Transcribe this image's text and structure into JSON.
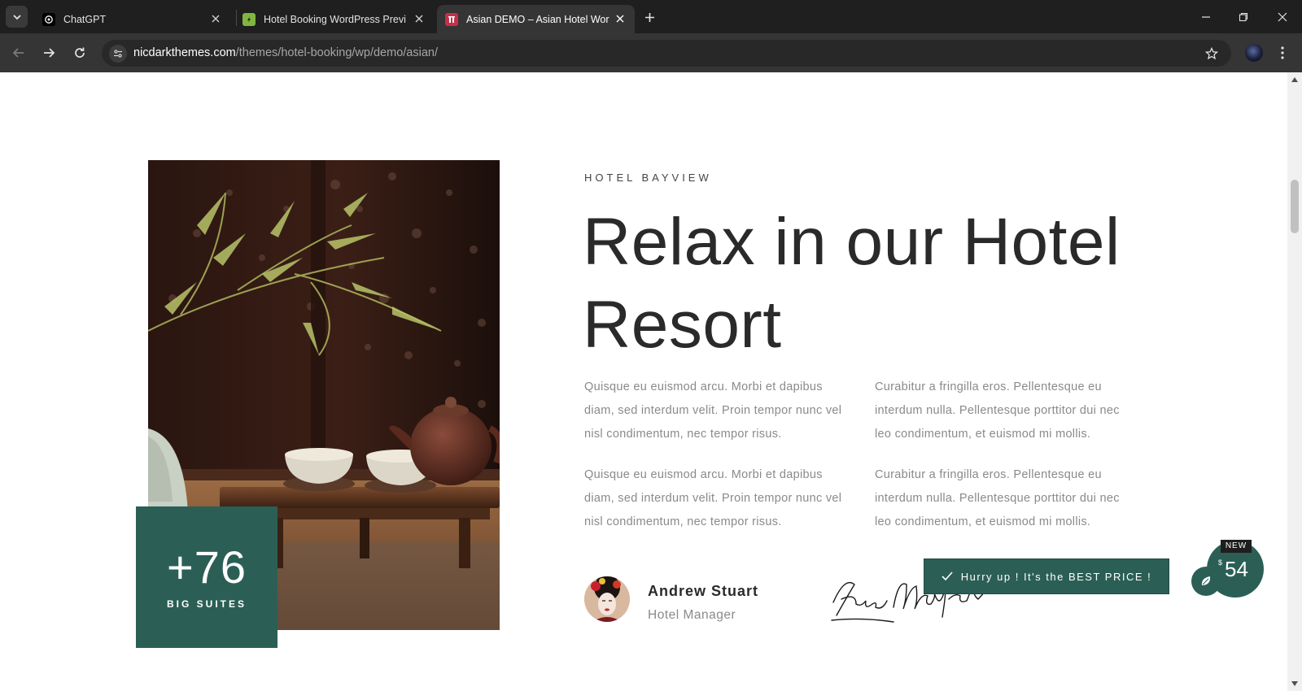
{
  "browser": {
    "tabs": [
      {
        "title": "ChatGPT",
        "icon": "chatgpt-icon",
        "active": false
      },
      {
        "title": "Hotel Booking WordPress Previ",
        "icon": "envato-icon",
        "active": false
      },
      {
        "title": "Asian DEMO – Asian Hotel Wor",
        "icon": "hotel-site-icon",
        "active": true
      }
    ],
    "url_host": "nicdarkthemes.com",
    "url_path": "/themes/hotel-booking/wp/demo/asian/"
  },
  "section": {
    "eyebrow": "HOTEL BAYVIEW",
    "headline_line1": "Relax in our Hotel",
    "headline_line2": "Resort",
    "paragraphs": [
      "Quisque eu euismod arcu. Morbi et dapibus diam, sed interdum velit. Proin tempor nunc vel nisl condimentum, nec tempor risus.",
      "Curabitur a fringilla eros. Pellentesque eu interdum nulla. Pellentesque porttitor dui nec leo condimentum, et euismod mi mollis.",
      "Quisque eu euismod arcu. Morbi et dapibus diam, sed interdum velit. Proin tempor nunc vel nisl condimentum, nec tempor risus.",
      "Curabitur a fringilla eros. Pellentesque eu interdum nulla. Pellentesque porttitor dui nec leo condimentum, et euismod mi mollis."
    ],
    "suites_count": "+76",
    "suites_label": "BIG SUITES",
    "author_name": "Andrew Stuart",
    "author_role": "Hotel Manager"
  },
  "promo": {
    "banner_text": "Hurry up ! It's the BEST PRICE !",
    "badge": "NEW",
    "currency": "$",
    "price": "54"
  },
  "colors": {
    "accent": "#2b5f55",
    "heading": "#2a2a2a",
    "body_text": "#8a8a8a",
    "chrome_dark": "#1f1f1f",
    "chrome_toolbar": "#353535"
  }
}
